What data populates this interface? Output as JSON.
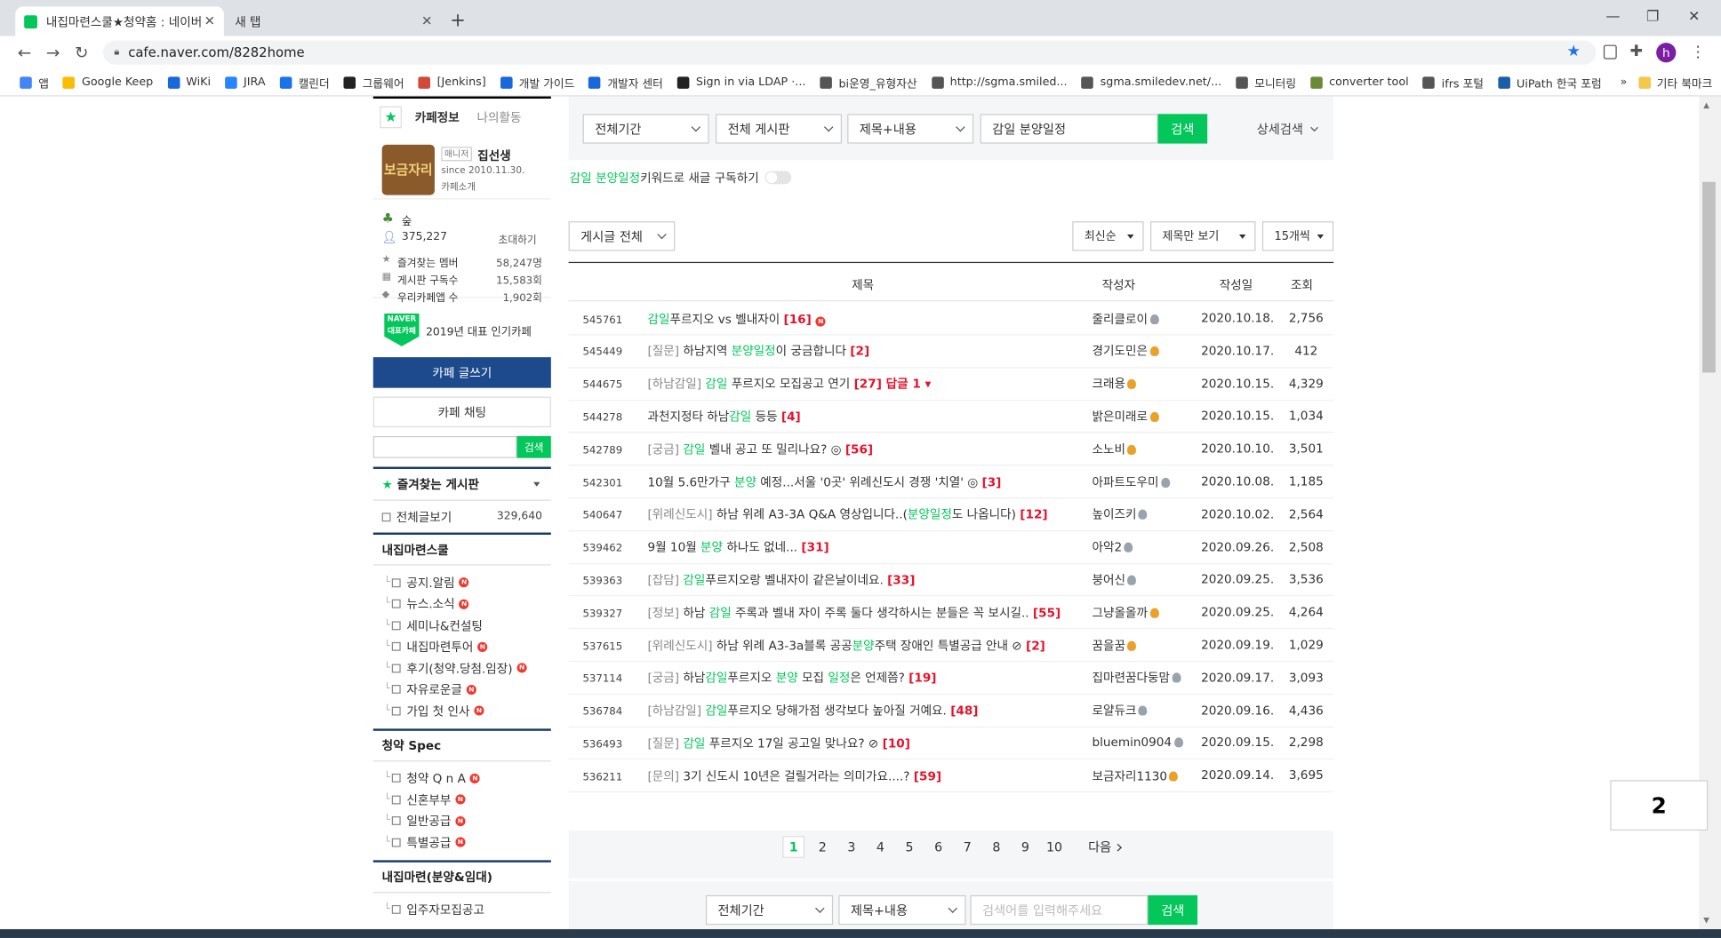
{
  "browser": {
    "tabs": [
      {
        "title": "내집마련스쿨★청약홈 : 네이버"
      },
      {
        "title": "새 탭"
      }
    ],
    "url": "cafe.naver.com/8282home",
    "avatar": "h",
    "bookmarks": [
      {
        "label": "앱",
        "icon": "apps-grid-icon",
        "color": "#4285f4"
      },
      {
        "label": "Google Keep",
        "icon": "keep-icon",
        "color": "#fbbc04"
      },
      {
        "label": "WiKi",
        "icon": "confluence-icon",
        "color": "#1868db"
      },
      {
        "label": "JIRA",
        "icon": "jira-icon",
        "color": "#2684ff"
      },
      {
        "label": "캘린더",
        "icon": "calendar-icon",
        "color": "#1a73e8"
      },
      {
        "label": "그룹웨어",
        "icon": "groupware-icon",
        "color": "#222222"
      },
      {
        "label": "[Jenkins]",
        "icon": "jenkins-icon",
        "color": "#d24939"
      },
      {
        "label": "개발 가이드",
        "icon": "confluence-icon",
        "color": "#1868db"
      },
      {
        "label": "개발자 센터",
        "icon": "confluence-icon",
        "color": "#1868db"
      },
      {
        "label": "Sign in via LDAP ·...",
        "icon": "github-icon",
        "color": "#222222"
      },
      {
        "label": "bi운영_유형자산",
        "icon": "globe-icon",
        "color": "#555555"
      },
      {
        "label": "http://sgma.smiled...",
        "icon": "globe-icon",
        "color": "#555555"
      },
      {
        "label": "sgma.smiledev.net/...",
        "icon": "globe-icon",
        "color": "#555555"
      },
      {
        "label": "모니터링",
        "icon": "globe-icon",
        "color": "#555555"
      },
      {
        "label": "converter tool",
        "icon": "converter-icon",
        "color": "#6a8a3a"
      },
      {
        "label": "ifrs 포털",
        "icon": "globe-icon",
        "color": "#555555"
      },
      {
        "label": "UiPath 한국 포럼",
        "icon": "uipath-icon",
        "color": "#1a5ea8"
      }
    ],
    "bookmarks_more": "»",
    "other_bookmarks": "기타 북마크"
  },
  "sidebar": {
    "tab_info": "카페정보",
    "tab_activity": "나의활동",
    "cafe_logo_text": "보금자리",
    "manager_badge": "매니저",
    "manager_name": "집선생",
    "since": "since 2010.11.30.",
    "intro_link": "카페소개",
    "level": "숲",
    "members": "375,227",
    "invite": "초대하기",
    "stats": [
      {
        "label": "즐겨찾는 멤버",
        "value": "58,247명"
      },
      {
        "label": "게시판 구독수",
        "value": "15,583회"
      },
      {
        "label": "우리카페앱 수",
        "value": "1,902회"
      }
    ],
    "naver_badge_top": "NAVER",
    "naver_badge_bottom": "대표카페",
    "award": "2019년 대표 인기카페",
    "write_button": "카페 글쓰기",
    "chat_button": "카페 채팅",
    "search_button": "검색",
    "favorites_title": "즐겨찾는 게시판",
    "all_posts_label": "전체글보기",
    "all_posts_count": "329,640",
    "groups": [
      {
        "title": "내집마련스쿨",
        "items": [
          {
            "label": "공지.알림",
            "n": true
          },
          {
            "label": "뉴스.소식",
            "n": true
          },
          {
            "label": "세미나&컨설팅",
            "n": false
          },
          {
            "label": "내집마련투어",
            "n": true
          },
          {
            "label": "후기(청약.당첨.임장)",
            "n": true
          },
          {
            "label": "자유로운글",
            "n": true
          },
          {
            "label": "가입 첫 인사",
            "n": true
          }
        ]
      },
      {
        "title": "청약 Spec",
        "items": [
          {
            "label": "청약 Q n A",
            "n": true
          },
          {
            "label": "신혼부부",
            "n": true
          },
          {
            "label": "일반공급",
            "n": true
          },
          {
            "label": "특별공급",
            "n": true
          }
        ]
      },
      {
        "title": "내집마련(분양&임대)",
        "items": [
          {
            "label": "입주자모집공고",
            "n": false
          }
        ]
      }
    ],
    "colors": {
      "accent": "#03c75a",
      "write_button_bg": "#1c4a8c",
      "new_badge": "#f1382f"
    }
  },
  "search": {
    "period": "전체기간",
    "board": "전체 게시판",
    "scope": "제목+내용",
    "query": "감일 분양일정",
    "button": "검색",
    "advanced": "상세검색"
  },
  "subscribe": {
    "keyword": "감일 분양일정",
    "text": " 키워드로 새글 구독하기"
  },
  "list_controls": {
    "filter": "게시글 전체",
    "sort": "최신순",
    "view": "제목만 보기",
    "per_page": "15개씩"
  },
  "table": {
    "headers": {
      "title": "제목",
      "author": "작성자",
      "date": "작성일",
      "views": "조회"
    },
    "rows": [
      {
        "num": "545761",
        "parts": [
          {
            "t": "감일",
            "c": "g"
          },
          {
            "t": "푸르지오 vs 벨내자이 "
          },
          {
            "t": "[16]",
            "c": "r"
          }
        ],
        "new": true,
        "author": "줄리클로이",
        "medal": "gray",
        "date": "2020.10.18.",
        "views": "2,756"
      },
      {
        "num": "545449",
        "parts": [
          {
            "t": "[질문] ",
            "c": "p"
          },
          {
            "t": "하남지역 "
          },
          {
            "t": "분양일정",
            "c": "g"
          },
          {
            "t": "이 궁금합니다 "
          },
          {
            "t": "[2]",
            "c": "r"
          }
        ],
        "author": "경기도민은",
        "medal": "gold",
        "date": "2020.10.17.",
        "views": "412"
      },
      {
        "num": "544675",
        "parts": [
          {
            "t": "[하남감일] ",
            "c": "p"
          },
          {
            "t": "감일",
            "c": "g"
          },
          {
            "t": " 푸르지오 모집공고 연기 "
          },
          {
            "t": "[27] 답글 1 ▾",
            "c": "r"
          }
        ],
        "author": "크래용",
        "medal": "gold",
        "date": "2020.10.15.",
        "views": "4,329"
      },
      {
        "num": "544278",
        "parts": [
          {
            "t": "과천지정타 하남"
          },
          {
            "t": "감일",
            "c": "g"
          },
          {
            "t": " 등등 "
          },
          {
            "t": "[4]",
            "c": "r"
          }
        ],
        "author": "밝은미래로",
        "medal": "gold",
        "date": "2020.10.15.",
        "views": "1,034"
      },
      {
        "num": "542789",
        "parts": [
          {
            "t": "[궁금] ",
            "c": "p"
          },
          {
            "t": "감일",
            "c": "g"
          },
          {
            "t": " 벨내 공고 또 밀리나요? ◎ "
          },
          {
            "t": "[56]",
            "c": "r"
          }
        ],
        "author": "소노비",
        "medal": "gold",
        "date": "2020.10.10.",
        "views": "3,501"
      },
      {
        "num": "542301",
        "parts": [
          {
            "t": "10월 5.6만가구 "
          },
          {
            "t": "분양",
            "c": "g"
          },
          {
            "t": " 예정...서울 '0곳' 위례신도시 경쟁 '치열' ◎ "
          },
          {
            "t": "[3]",
            "c": "r"
          }
        ],
        "author": "아파트도우미",
        "medal": "gray",
        "date": "2020.10.08.",
        "views": "1,185"
      },
      {
        "num": "540647",
        "parts": [
          {
            "t": "[위례신도시] ",
            "c": "p"
          },
          {
            "t": "하남 위례 A3-3A Q&A 영상입니다..("
          },
          {
            "t": "분양일정",
            "c": "g"
          },
          {
            "t": "도 나옵니다) "
          },
          {
            "t": "[12]",
            "c": "r"
          }
        ],
        "author": "높이즈키",
        "medal": "gray",
        "date": "2020.10.02.",
        "views": "2,564"
      },
      {
        "num": "539462",
        "parts": [
          {
            "t": "9월 10월 "
          },
          {
            "t": "분양",
            "c": "g"
          },
          {
            "t": " 하나도 없네... "
          },
          {
            "t": "[31]",
            "c": "r"
          }
        ],
        "author": "아악2",
        "medal": "gray",
        "date": "2020.09.26.",
        "views": "2,508"
      },
      {
        "num": "539363",
        "parts": [
          {
            "t": "[잡담] ",
            "c": "p"
          },
          {
            "t": "감일",
            "c": "g"
          },
          {
            "t": "푸르지오랑 벨내자이 같은날이네요. "
          },
          {
            "t": "[33]",
            "c": "r"
          }
        ],
        "author": "붕어신",
        "medal": "gray",
        "date": "2020.09.25.",
        "views": "3,536"
      },
      {
        "num": "539327",
        "parts": [
          {
            "t": "[정보] ",
            "c": "p"
          },
          {
            "t": "하남 "
          },
          {
            "t": "감일",
            "c": "g"
          },
          {
            "t": " 주록과 벨내 자이 주록 둘다 생각하시는 분들은 꼭 보시길.. "
          },
          {
            "t": "[55]",
            "c": "r"
          }
        ],
        "author": "그냥올올까",
        "medal": "gold",
        "date": "2020.09.25.",
        "views": "4,264"
      },
      {
        "num": "537615",
        "parts": [
          {
            "t": "[위례신도시] ",
            "c": "p"
          },
          {
            "t": "하남 위례 A3-3a블록 공공"
          },
          {
            "t": "분양",
            "c": "g"
          },
          {
            "t": "주택 장애인 특별공급 안내 ⊘ "
          },
          {
            "t": "[2]",
            "c": "r"
          }
        ],
        "author": "꿈을꿈",
        "medal": "gold",
        "date": "2020.09.19.",
        "views": "1,029"
      },
      {
        "num": "537114",
        "parts": [
          {
            "t": "[궁금] ",
            "c": "p"
          },
          {
            "t": "하남"
          },
          {
            "t": "감일",
            "c": "g"
          },
          {
            "t": "푸르지오 "
          },
          {
            "t": "분양",
            "c": "g"
          },
          {
            "t": " 모집 "
          },
          {
            "t": "일정",
            "c": "g"
          },
          {
            "t": "은 언제쯤? "
          },
          {
            "t": "[19]",
            "c": "r"
          }
        ],
        "author": "집마련꿈다둥맘",
        "medal": "gray",
        "date": "2020.09.17.",
        "views": "3,093"
      },
      {
        "num": "536784",
        "parts": [
          {
            "t": "[하남감일] ",
            "c": "p"
          },
          {
            "t": "감일",
            "c": "g"
          },
          {
            "t": "푸르지오 당해가점 생각보다 높아질 거예요. "
          },
          {
            "t": "[48]",
            "c": "r"
          }
        ],
        "author": "로얄듀크",
        "medal": "gray",
        "date": "2020.09.16.",
        "views": "4,436"
      },
      {
        "num": "536493",
        "parts": [
          {
            "t": "[질문] ",
            "c": "p"
          },
          {
            "t": "감일",
            "c": "g"
          },
          {
            "t": " 푸르지오 17일 공고일 맞나요? ⊘ "
          },
          {
            "t": "[10]",
            "c": "r"
          }
        ],
        "author": "bluemin0904",
        "medal": "gray",
        "date": "2020.09.15.",
        "views": "2,298"
      },
      {
        "num": "536211",
        "parts": [
          {
            "t": "[문의] ",
            "c": "p"
          },
          {
            "t": "3기 신도시 10년은 걸릴거라는 의미가요....? "
          },
          {
            "t": "[59]",
            "c": "r"
          }
        ],
        "author": "보금자리1130",
        "medal": "gold",
        "date": "2020.09.14.",
        "views": "3,695"
      }
    ]
  },
  "pagination": {
    "pages": [
      "1",
      "2",
      "3",
      "4",
      "5",
      "6",
      "7",
      "8",
      "9",
      "10"
    ],
    "current": "1",
    "next": "다음"
  },
  "bottom_search": {
    "period": "전체기간",
    "scope": "제목+내용",
    "placeholder": "검색어를 입력해주세요",
    "button": "검색"
  },
  "corner_badge": "2"
}
